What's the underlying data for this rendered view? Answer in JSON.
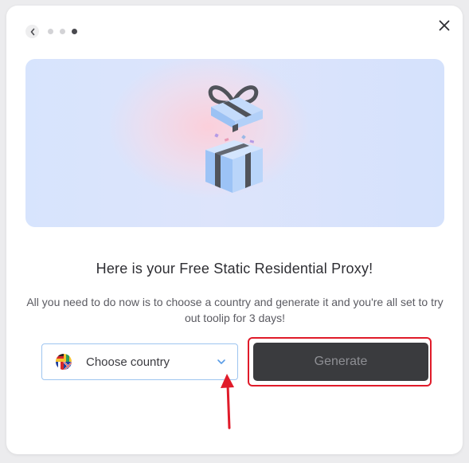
{
  "modal": {
    "stepper": {
      "back_icon": "chevron-left-icon",
      "steps_total": 3,
      "active_step": 3
    },
    "close_icon": "close-icon",
    "hero": {
      "illustration": "gift-box-icon",
      "colors": {
        "box": "#a9cbf8",
        "ribbon": "#50535a"
      }
    },
    "title": "Here is your Free Static Residential Proxy!",
    "description": "All you need to do now is to choose a country and generate it and you're all set to try out toolip for 3 days!",
    "country_select": {
      "placeholder": "Choose country",
      "icon": "flags-icon",
      "chevron": "chevron-down-icon"
    },
    "generate_button": {
      "label": "Generate",
      "state": "disabled"
    },
    "annotations": {
      "highlight_color": "#e01b2a",
      "arrow_color": "#e01b2a"
    }
  }
}
